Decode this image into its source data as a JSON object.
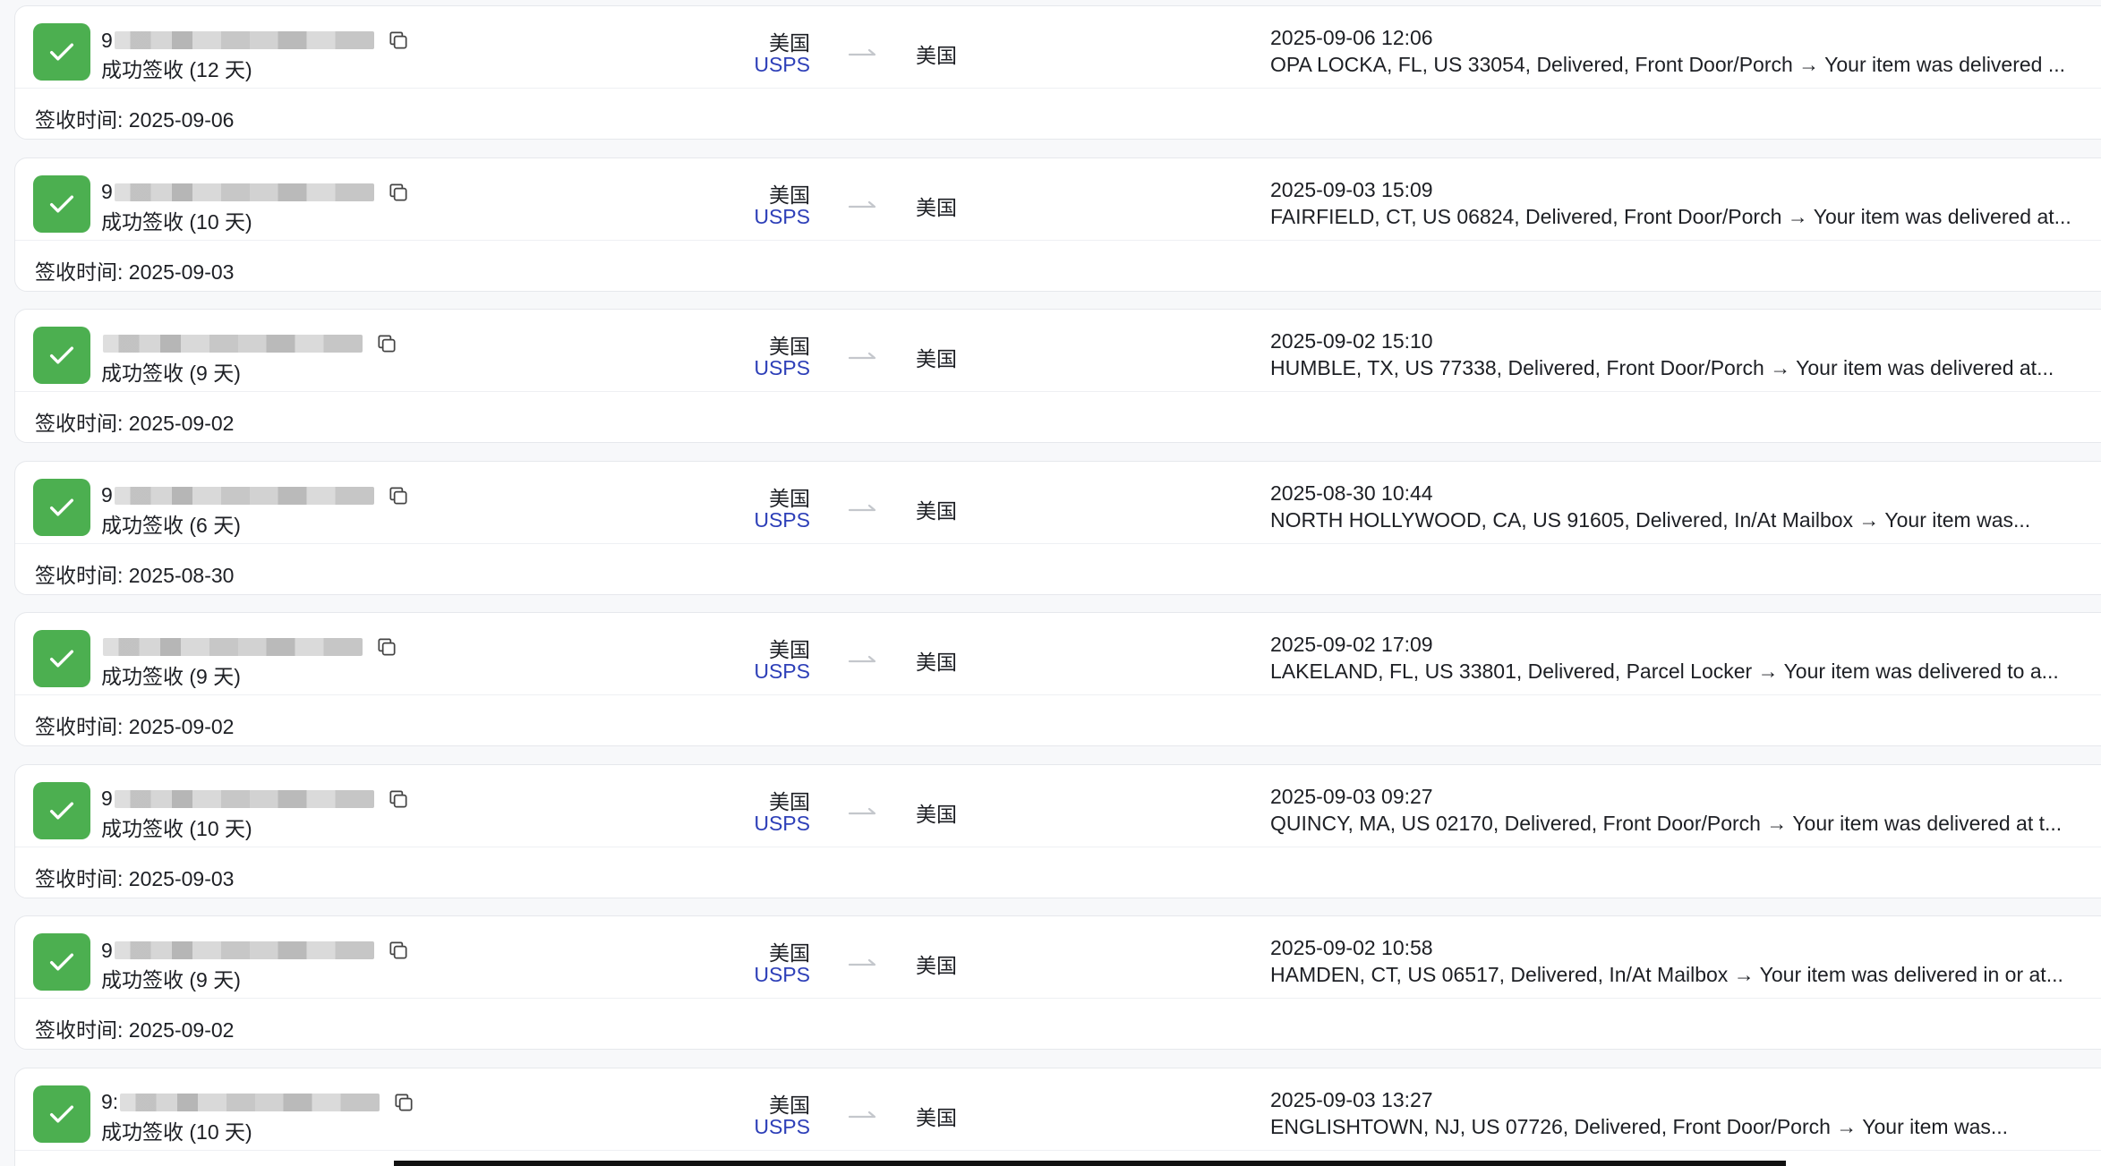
{
  "colors": {
    "success": "#4caf50",
    "carrier_link": "#2d3fb8",
    "card_bg": "#ffffff",
    "page_bg": "#f7f8fa"
  },
  "icons": {
    "status": "check-icon",
    "copy": "copy-icon",
    "route": "route-arrow-icon"
  },
  "shipments": [
    {
      "tracking_visible": "9",
      "status": "成功签收 (12 天)",
      "origin": "美国",
      "carrier": "USPS",
      "destination": "美国",
      "event_time": "2025-09-06 12:06",
      "event_detail": "OPA LOCKA, FL, US 33054, Delivered, Front Door/Porch → Your item was delivered ...",
      "sign_time": "签收时间: 2025-09-06"
    },
    {
      "tracking_visible": "9",
      "status": "成功签收 (10 天)",
      "origin": "美国",
      "carrier": "USPS",
      "destination": "美国",
      "event_time": "2025-09-03 15:09",
      "event_detail": "FAIRFIELD, CT, US 06824, Delivered, Front Door/Porch → Your item was delivered at...",
      "sign_time": "签收时间: 2025-09-03"
    },
    {
      "tracking_visible": "",
      "status": "成功签收 (9 天)",
      "origin": "美国",
      "carrier": "USPS",
      "destination": "美国",
      "event_time": "2025-09-02 15:10",
      "event_detail": "HUMBLE, TX, US 77338, Delivered, Front Door/Porch → Your item was delivered at...",
      "sign_time": "签收时间: 2025-09-02"
    },
    {
      "tracking_visible": "9",
      "status": "成功签收 (6 天)",
      "origin": "美国",
      "carrier": "USPS",
      "destination": "美国",
      "event_time": "2025-08-30 10:44",
      "event_detail": "NORTH HOLLYWOOD, CA, US 91605, Delivered, In/At Mailbox → Your item was...",
      "sign_time": "签收时间: 2025-08-30"
    },
    {
      "tracking_visible": "",
      "status": "成功签收 (9 天)",
      "origin": "美国",
      "carrier": "USPS",
      "destination": "美国",
      "event_time": "2025-09-02 17:09",
      "event_detail": "LAKELAND, FL, US 33801, Delivered, Parcel Locker → Your item was delivered to a...",
      "sign_time": "签收时间: 2025-09-02"
    },
    {
      "tracking_visible": "9",
      "status": "成功签收 (10 天)",
      "origin": "美国",
      "carrier": "USPS",
      "destination": "美国",
      "event_time": "2025-09-03 09:27",
      "event_detail": "QUINCY, MA, US 02170, Delivered, Front Door/Porch → Your item was delivered at t...",
      "sign_time": "签收时间: 2025-09-03"
    },
    {
      "tracking_visible": "9",
      "status": "成功签收 (9 天)",
      "origin": "美国",
      "carrier": "USPS",
      "destination": "美国",
      "event_time": "2025-09-02 10:58",
      "event_detail": "HAMDEN, CT, US 06517, Delivered, In/At Mailbox → Your item was delivered in or at...",
      "sign_time": "签收时间: 2025-09-02"
    },
    {
      "tracking_visible": "9:",
      "status": "成功签收 (10 天)",
      "origin": "美国",
      "carrier": "USPS",
      "destination": "美国",
      "event_time": "2025-09-03 13:27",
      "event_detail": "ENGLISHTOWN, NJ, US 07726, Delivered, Front Door/Porch → Your item was...",
      "sign_time": ""
    }
  ]
}
